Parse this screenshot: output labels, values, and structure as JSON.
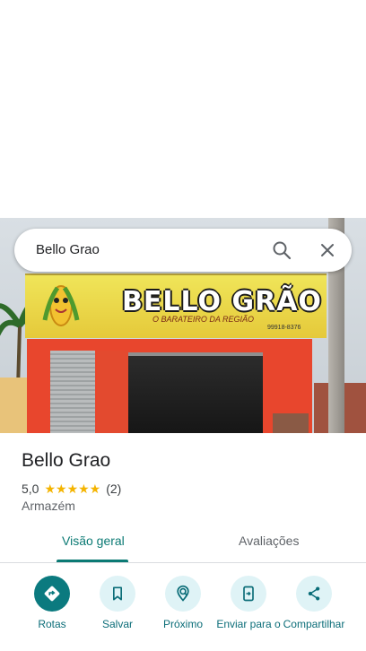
{
  "search": {
    "query": "Bello Grao"
  },
  "photo": {
    "sign_title": "BELLO GRÃO",
    "sign_subtitle": "O BARATEIRO DA REGIÃO",
    "sign_phone": "99918-8376"
  },
  "place": {
    "name": "Bello Grao",
    "rating": "5,0",
    "stars": "★★★★★",
    "review_count": "(2)",
    "category": "Armazém"
  },
  "tabs": [
    {
      "label": "Visão geral",
      "selected": true
    },
    {
      "label": "Avaliações",
      "selected": false
    }
  ],
  "actions": [
    {
      "label": "Rotas",
      "icon": "directions-icon"
    },
    {
      "label": "Salvar",
      "icon": "bookmark-icon"
    },
    {
      "label": "Próximo",
      "icon": "nearby-icon"
    },
    {
      "label": "Enviar para o",
      "icon": "send-to-phone-icon"
    },
    {
      "label": "Compartilhar",
      "icon": "share-icon"
    }
  ],
  "colors": {
    "accent": "#0b7a7f",
    "star": "#f4b400",
    "action_bg": "#dff3f6"
  }
}
